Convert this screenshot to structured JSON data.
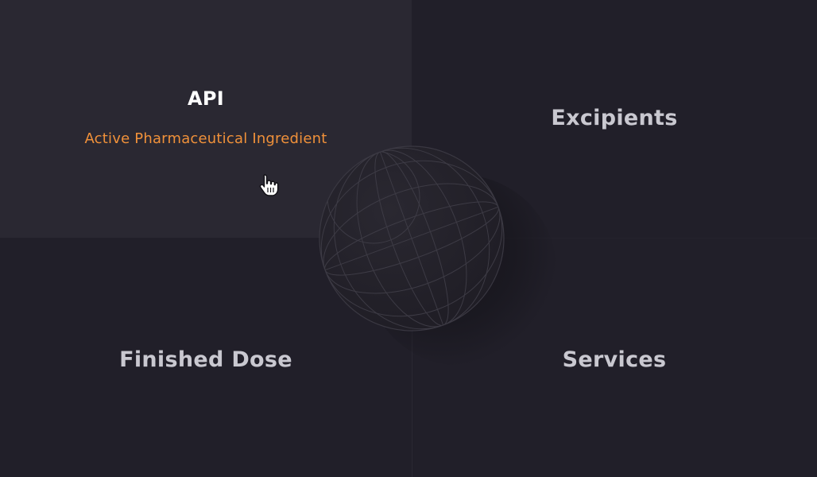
{
  "tiles": {
    "api": {
      "title": "API",
      "subtitle": "Active Pharmaceutical Ingredient"
    },
    "excipients": {
      "title": "Excipients"
    },
    "finished_dose": {
      "title": "Finished Dose"
    },
    "services": {
      "title": "Services"
    }
  },
  "colors": {
    "background": "#211f29",
    "active_tile": "#2a2832",
    "accent": "#f0913a",
    "title_active": "#ffffff",
    "title_inactive": "#c9c8d0"
  },
  "icons": {
    "center": "globe-icon",
    "pointer": "hand-pointer-cursor-icon"
  }
}
